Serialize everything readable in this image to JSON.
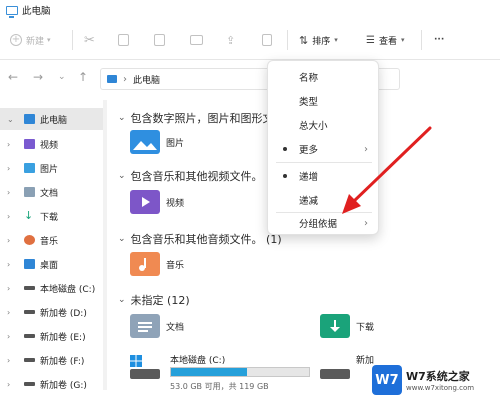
{
  "window": {
    "title": "此电脑"
  },
  "toolbar": {
    "new_label": "新建",
    "sort_label": "排序",
    "view_label": "查看",
    "more_label": "···"
  },
  "address": {
    "path": "此电脑"
  },
  "sidebar": {
    "items": [
      {
        "label": "此电脑",
        "color": "#2f86d6",
        "selected": true
      },
      {
        "label": "视频",
        "color": "#7a5ad0"
      },
      {
        "label": "图片",
        "color": "#3aa0e0"
      },
      {
        "label": "文档",
        "color": "#8aa0b4"
      },
      {
        "label": "下载",
        "color": "#1aa37a"
      },
      {
        "label": "音乐",
        "color": "#e07040"
      },
      {
        "label": "桌面",
        "color": "#2f86d6"
      },
      {
        "label": "本地磁盘 (C:)",
        "color": "#555555"
      },
      {
        "label": "新加卷 (D:)",
        "color": "#555555"
      },
      {
        "label": "新加卷 (E:)",
        "color": "#555555"
      },
      {
        "label": "新加卷 (F:)",
        "color": "#555555"
      },
      {
        "label": "新加卷 (G:)",
        "color": "#555555"
      }
    ]
  },
  "groups": [
    {
      "header": "包含数字照片，图片和图形文",
      "items": [
        {
          "label": "图片",
          "icon": "pictures-folder-icon"
        }
      ]
    },
    {
      "header": "包含音乐和其他视频文件。",
      "items": [
        {
          "label": "视频",
          "icon": "videos-folder-icon"
        }
      ]
    },
    {
      "header": "包含音乐和其他音频文件。 (1)",
      "items": [
        {
          "label": "音乐",
          "icon": "music-folder-icon"
        }
      ]
    },
    {
      "header": "未指定 (12)",
      "items": [
        {
          "label": "文档",
          "icon": "documents-folder-icon"
        },
        {
          "label": "下载",
          "icon": "downloads-folder-icon"
        },
        {
          "label": "本地磁盘 (C:)",
          "icon": "drive-icon",
          "free_text": "53.0 GB 可用，共 119 GB",
          "used_fraction": 0.55
        },
        {
          "label": "新加",
          "icon": "drive-icon"
        }
      ]
    }
  ],
  "sort_menu": {
    "items": [
      {
        "label": "名称"
      },
      {
        "label": "类型"
      },
      {
        "label": "总大小"
      },
      {
        "label": "更多",
        "selected": true,
        "submenu": true
      },
      {
        "label": "递增",
        "selected": true
      },
      {
        "label": "递减"
      },
      {
        "label": "分组依据",
        "submenu": true
      }
    ]
  },
  "watermark": {
    "badge": "W7",
    "title": "W7系统之家",
    "subtitle": "www.w7xitong.com"
  },
  "colors": {
    "accent": "#2f86d6",
    "arrow": "#e02020",
    "bar_fill": "#26a0da"
  }
}
